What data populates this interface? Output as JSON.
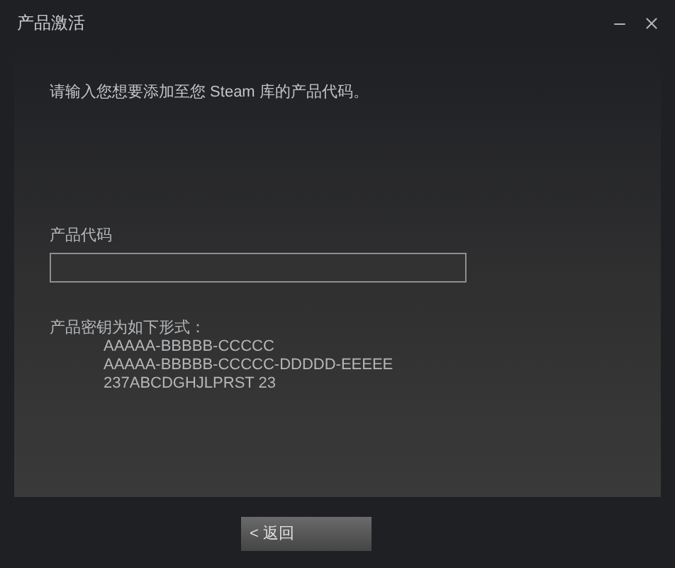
{
  "window": {
    "title": "产品激活"
  },
  "description": "请输入您想要添加至您 Steam 库的产品代码。",
  "code_field": {
    "label": "产品代码"
  },
  "formats": {
    "heading": "产品密钥为如下形式：",
    "examples": [
      "AAAAA-BBBBB-CCCCC",
      "AAAAA-BBBBB-CCCCC-DDDDD-EEEEE",
      "237ABCDGHJLPRST 23"
    ]
  },
  "buttons": [
    {
      "label": "< 返回"
    }
  ]
}
